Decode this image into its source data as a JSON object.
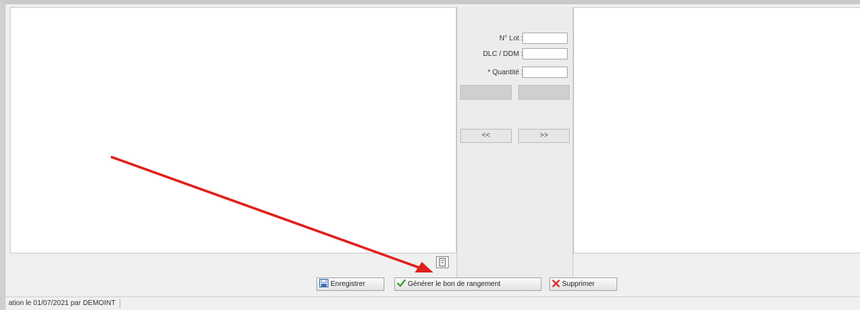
{
  "form": {
    "lot_label": "N° Lot :",
    "lot_value": "",
    "dlc_label": "DLC / DDM :",
    "dlc_value": "",
    "quantity_label": "* Quantité :",
    "quantity_value": ""
  },
  "navigation": {
    "prev_label": "<<",
    "next_label": ">>"
  },
  "actions": {
    "save_label": "Enregistrer",
    "generate_label": "Générer le bon de rangement",
    "delete_label": "Supprimer"
  },
  "status": {
    "text": "ation le 01/07/2021 par DEMOINT"
  },
  "colors": {
    "annotation_arrow": "#e0201b",
    "check_icon": "#2e9e2e",
    "delete_icon": "#d83030",
    "save_icon": "#3b6fb0"
  },
  "icons": {
    "save": "floppy-disk-icon",
    "generate": "checkmark-icon",
    "delete": "red-x-icon",
    "small_button": "document-icon"
  }
}
